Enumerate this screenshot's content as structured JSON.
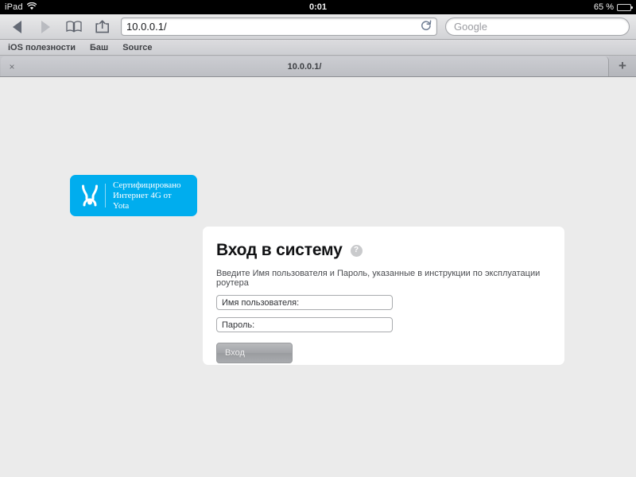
{
  "statusbar": {
    "carrier": "iPad",
    "wifi_icon": "wifi-icon",
    "time": "0:01",
    "battery_percent": "65 %",
    "battery_icon": "battery-icon"
  },
  "toolbar": {
    "back_icon": "back-arrow-icon",
    "forward_icon": "forward-arrow-icon",
    "bookmarks_icon": "book-icon",
    "share_icon": "share-icon",
    "url_value": "10.0.0.1/",
    "reload_icon": "reload-icon",
    "search_placeholder": "Google"
  },
  "bookmarks_bar": {
    "items": [
      {
        "label": "iOS полезности"
      },
      {
        "label": "Баш"
      },
      {
        "label": "Source"
      }
    ]
  },
  "tabbar": {
    "close_label": "×",
    "tab_title": "10.0.0.1/",
    "new_tab_label": "+"
  },
  "page": {
    "background_color": "#ebebeb",
    "yota_badge": {
      "background_color": "#00adee",
      "logo_icon": "yota-logo-icon",
      "line1": "Сертифицировано",
      "line2": "Интернет 4G от Yota"
    },
    "login_card": {
      "title": "Вход в систему",
      "help_icon": "help-question-icon",
      "help_label": "?",
      "subtitle": "Введите Имя пользователя и Пароль, указанные в инструкции по эксплуатации роутера",
      "username_placeholder": "Имя пользователя:",
      "username_value": "",
      "password_placeholder": "Пароль:",
      "password_value": "",
      "submit_label": "Вход"
    }
  }
}
